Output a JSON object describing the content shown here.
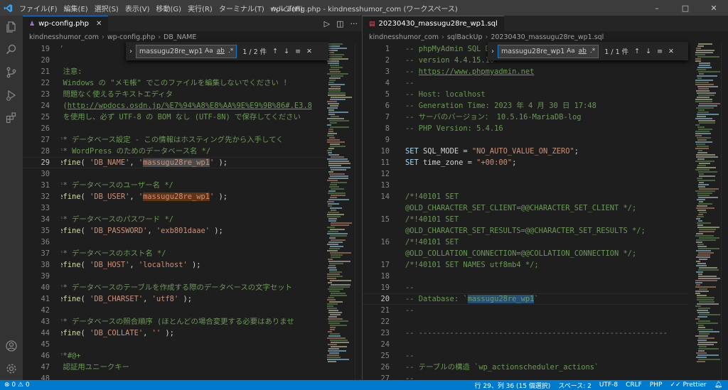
{
  "titlebar": {
    "menu": [
      "ファイル(F)",
      "編集(E)",
      "選択(S)",
      "表示(V)",
      "移動(G)",
      "実行(R)",
      "ターミナル(T)",
      "ヘルプ(H)"
    ],
    "title": "wp-config.php - kindnesshumor_com (ワークスペース)",
    "window_controls": [
      "–",
      "□",
      "✕"
    ]
  },
  "left_editor": {
    "tab_label": "wp-config.php",
    "breadcrumb": [
      "kindnesshumor_com",
      "wp-config.php",
      "DB_NAME"
    ],
    "find": {
      "query": "massugu28re_wp1",
      "count": "1 / 2 件",
      "opt_case": "Aa",
      "opt_word": "ab",
      "opt_regex": ".*"
    },
    "lines": [
      {
        "n": "19",
        "cur": false,
        "segs": [
          {
            "t": "*/",
            "c": "cmt"
          }
        ]
      },
      {
        "n": "20",
        "cur": false,
        "segs": []
      },
      {
        "n": "21",
        "cur": false,
        "segs": [
          {
            "t": "* 注意:",
            "c": "cmt"
          }
        ]
      },
      {
        "n": "22",
        "cur": false,
        "segs": [
          {
            "t": "* Windows の \"メモ帳\" でこのファイルを編集しないでください !",
            "c": "cmt"
          }
        ]
      },
      {
        "n": "23",
        "cur": false,
        "segs": [
          {
            "t": "* 問題なく使えるテキストエディタ",
            "c": "cmt"
          }
        ]
      },
      {
        "n": "24",
        "cur": false,
        "segs": [
          {
            "t": "* (",
            "c": "cmt"
          },
          {
            "t": "http://wpdocs.osdn.jp/%E7%94%A8%E8%AA%9E%E9%9B%86#.E3.8",
            "c": "link"
          }
        ]
      },
      {
        "n": "25",
        "cur": false,
        "segs": [
          {
            "t": "* を使用し、必ず UTF-8 の BOM なし (UTF-8N) で保存してください",
            "c": "cmt"
          }
        ]
      },
      {
        "n": "26",
        "cur": false,
        "segs": []
      },
      {
        "n": "27",
        "cur": false,
        "segs": [
          {
            "t": "/** データベース設定 - この情報はホスティング先から入手してく",
            "c": "cmt"
          }
        ]
      },
      {
        "n": "28",
        "cur": false,
        "segs": [
          {
            "t": "/** WordPress のためのデータベース名 */",
            "c": "cmt"
          }
        ]
      },
      {
        "n": "29",
        "cur": true,
        "segs": [
          {
            "t": "define",
            "c": "fn"
          },
          {
            "t": "( ",
            "c": "pl"
          },
          {
            "t": "'DB_NAME'",
            "c": "str"
          },
          {
            "t": ", ",
            "c": "pl"
          },
          {
            "t": "'",
            "c": "str"
          },
          {
            "t": "massugu28re_wp1",
            "c": "str hl1"
          },
          {
            "t": "'",
            "c": "str"
          },
          {
            "t": " );",
            "c": "pl"
          }
        ]
      },
      {
        "n": "30",
        "cur": false,
        "segs": []
      },
      {
        "n": "31",
        "cur": false,
        "segs": [
          {
            "t": "/** データベースのユーザー名 */",
            "c": "cmt"
          }
        ]
      },
      {
        "n": "32",
        "cur": false,
        "segs": [
          {
            "t": "define",
            "c": "fn"
          },
          {
            "t": "( ",
            "c": "pl"
          },
          {
            "t": "'DB_USER'",
            "c": "str"
          },
          {
            "t": ", ",
            "c": "pl"
          },
          {
            "t": "'",
            "c": "str"
          },
          {
            "t": "massugu28re_wp1",
            "c": "str hl2"
          },
          {
            "t": "'",
            "c": "str"
          },
          {
            "t": " );",
            "c": "pl"
          }
        ]
      },
      {
        "n": "33",
        "cur": false,
        "segs": []
      },
      {
        "n": "34",
        "cur": false,
        "segs": [
          {
            "t": "/** データベースのパスワード */",
            "c": "cmt"
          }
        ]
      },
      {
        "n": "35",
        "cur": false,
        "segs": [
          {
            "t": "define",
            "c": "fn"
          },
          {
            "t": "( ",
            "c": "pl"
          },
          {
            "t": "'DB_PASSWORD'",
            "c": "str"
          },
          {
            "t": ", ",
            "c": "pl"
          },
          {
            "t": "'exb801daae'",
            "c": "str"
          },
          {
            "t": " );",
            "c": "pl"
          }
        ]
      },
      {
        "n": "36",
        "cur": false,
        "segs": []
      },
      {
        "n": "37",
        "cur": false,
        "segs": [
          {
            "t": "/** データベースのホスト名 */",
            "c": "cmt"
          }
        ]
      },
      {
        "n": "38",
        "cur": false,
        "segs": [
          {
            "t": "define",
            "c": "fn"
          },
          {
            "t": "( ",
            "c": "pl"
          },
          {
            "t": "'DB_HOST'",
            "c": "str"
          },
          {
            "t": ", ",
            "c": "pl"
          },
          {
            "t": "'localhost'",
            "c": "str"
          },
          {
            "t": " );",
            "c": "pl"
          }
        ]
      },
      {
        "n": "39",
        "cur": false,
        "segs": []
      },
      {
        "n": "40",
        "cur": false,
        "segs": [
          {
            "t": "/** データベースのテーブルを作成する際のデータベースの文字セット",
            "c": "cmt"
          }
        ]
      },
      {
        "n": "41",
        "cur": false,
        "segs": [
          {
            "t": "define",
            "c": "fn"
          },
          {
            "t": "( ",
            "c": "pl"
          },
          {
            "t": "'DB_CHARSET'",
            "c": "str"
          },
          {
            "t": ", ",
            "c": "pl"
          },
          {
            "t": "'utf8'",
            "c": "str"
          },
          {
            "t": " );",
            "c": "pl"
          }
        ]
      },
      {
        "n": "42",
        "cur": false,
        "segs": []
      },
      {
        "n": "43",
        "cur": false,
        "segs": [
          {
            "t": "/** データベースの照合順序 (ほとんどの場合変更する必要はありませ",
            "c": "cmt"
          }
        ]
      },
      {
        "n": "44",
        "cur": false,
        "segs": [
          {
            "t": "define",
            "c": "fn"
          },
          {
            "t": "( ",
            "c": "pl"
          },
          {
            "t": "'DB_COLLATE'",
            "c": "str"
          },
          {
            "t": ", ",
            "c": "pl"
          },
          {
            "t": "''",
            "c": "str"
          },
          {
            "t": " );",
            "c": "pl"
          }
        ]
      },
      {
        "n": "45",
        "cur": false,
        "segs": []
      },
      {
        "n": "46",
        "cur": false,
        "segs": [
          {
            "t": "/**#@+",
            "c": "cmt"
          }
        ]
      },
      {
        "n": "47",
        "cur": false,
        "segs": [
          {
            "t": "* 認証用ユニークキー",
            "c": "cmt"
          }
        ]
      },
      {
        "n": "48",
        "cur": false,
        "segs": [
          {
            "t": "*",
            "c": "cmt"
          }
        ]
      }
    ]
  },
  "right_editor": {
    "tab_label": "20230430_massugu28re_wp1.sql",
    "breadcrumb": [
      "kindnesshumor_com",
      "sqlBackUp",
      "20230430_massugu28re_wp1.sql"
    ],
    "find": {
      "query": "massugu28re_wp1",
      "count": "1 / 1 件",
      "opt_case": "Aa",
      "opt_word": "ab",
      "opt_regex": ".*"
    },
    "lines": [
      {
        "n": "1",
        "cur": false,
        "segs": [
          {
            "t": "-- phpMyAdmin SQL Dump",
            "c": "cmt"
          }
        ]
      },
      {
        "n": "2",
        "cur": false,
        "segs": [
          {
            "t": "-- version 4.4.15.10",
            "c": "cmt"
          }
        ]
      },
      {
        "n": "3",
        "cur": false,
        "segs": [
          {
            "t": "-- ",
            "c": "cmt"
          },
          {
            "t": "https://www.phpmyadmin.net",
            "c": "link"
          }
        ]
      },
      {
        "n": "4",
        "cur": false,
        "segs": [
          {
            "t": "--",
            "c": "cmt"
          }
        ]
      },
      {
        "n": "5",
        "cur": false,
        "segs": [
          {
            "t": "-- Host: localhost",
            "c": "cmt"
          }
        ]
      },
      {
        "n": "6",
        "cur": false,
        "segs": [
          {
            "t": "-- Generation Time: 2023 年 4 月 30 日 17:48",
            "c": "cmt"
          }
        ]
      },
      {
        "n": "7",
        "cur": false,
        "segs": [
          {
            "t": "-- サーバのバージョン： 10.5.16-MariaDB-log",
            "c": "cmt"
          }
        ]
      },
      {
        "n": "8",
        "cur": false,
        "segs": [
          {
            "t": "-- PHP Version: 5.4.16",
            "c": "cmt"
          }
        ]
      },
      {
        "n": "9",
        "cur": false,
        "segs": []
      },
      {
        "n": "10",
        "cur": false,
        "segs": [
          {
            "t": "SET",
            "c": "kw"
          },
          {
            "t": " SQL_MODE = ",
            "c": "pl"
          },
          {
            "t": "\"NO_AUTO_VALUE_ON_ZERO\"",
            "c": "str"
          },
          {
            "t": ";",
            "c": "pl"
          }
        ]
      },
      {
        "n": "11",
        "cur": false,
        "segs": [
          {
            "t": "SET",
            "c": "kw"
          },
          {
            "t": " time_zone = ",
            "c": "pl"
          },
          {
            "t": "\"+00:00\"",
            "c": "str"
          },
          {
            "t": ";",
            "c": "pl"
          }
        ]
      },
      {
        "n": "12",
        "cur": false,
        "segs": []
      },
      {
        "n": "13",
        "cur": false,
        "segs": []
      },
      {
        "n": "14",
        "cur": false,
        "segs": [
          {
            "t": "/*!40101 SET",
            "c": "cmt"
          }
        ]
      },
      {
        "n": "",
        "cur": false,
        "segs": [
          {
            "t": "@OLD_CHARACTER_SET_CLIENT=@@CHARACTER_SET_CLIENT */;",
            "c": "cmt"
          }
        ]
      },
      {
        "n": "15",
        "cur": false,
        "segs": [
          {
            "t": "/*!40101 SET",
            "c": "cmt"
          }
        ]
      },
      {
        "n": "",
        "cur": false,
        "segs": [
          {
            "t": "@OLD_CHARACTER_SET_RESULTS=@@CHARACTER_SET_RESULTS */;",
            "c": "cmt"
          }
        ]
      },
      {
        "n": "16",
        "cur": false,
        "segs": [
          {
            "t": "/*!40101 SET",
            "c": "cmt"
          }
        ]
      },
      {
        "n": "",
        "cur": false,
        "segs": [
          {
            "t": "@OLD_COLLATION_CONNECTION=@@COLLATION_CONNECTION */;",
            "c": "cmt"
          }
        ]
      },
      {
        "n": "17",
        "cur": false,
        "segs": [
          {
            "t": "/*!40101 SET NAMES utf8mb4 */;",
            "c": "cmt"
          }
        ]
      },
      {
        "n": "18",
        "cur": false,
        "segs": []
      },
      {
        "n": "19",
        "cur": false,
        "segs": [
          {
            "t": "--",
            "c": "cmt"
          }
        ]
      },
      {
        "n": "20",
        "cur": true,
        "segs": [
          {
            "t": "-- Database: `",
            "c": "cmt"
          },
          {
            "t": "massugu28re_wp1",
            "c": "cmt hl3"
          },
          {
            "t": "`",
            "c": "cmt"
          }
        ]
      },
      {
        "n": "21",
        "cur": false,
        "segs": [
          {
            "t": "--",
            "c": "cmt"
          }
        ]
      },
      {
        "n": "22",
        "cur": false,
        "segs": []
      },
      {
        "n": "23",
        "cur": false,
        "segs": [
          {
            "t": "-- --------------------------------------------------------",
            "c": "cmt"
          }
        ]
      },
      {
        "n": "24",
        "cur": false,
        "segs": []
      },
      {
        "n": "25",
        "cur": false,
        "segs": [
          {
            "t": "--",
            "c": "cmt"
          }
        ]
      },
      {
        "n": "26",
        "cur": false,
        "segs": [
          {
            "t": "-- テーブルの構造 `wp_actionscheduler_actions`",
            "c": "cmt"
          }
        ]
      },
      {
        "n": "27",
        "cur": false,
        "segs": [
          {
            "t": "--",
            "c": "cmt"
          }
        ]
      }
    ]
  },
  "statusbar": {
    "errors": "0",
    "warnings": "0",
    "cursor_pos": "行 29、列 36 (15 個選択)",
    "indent": "スペース: 2",
    "encoding": "UTF-8",
    "eol": "CRLF",
    "language": "PHP",
    "formatter": "Prettier"
  },
  "colors": {
    "statusbar": "#007acc",
    "accent": "#0e7ad3",
    "comment": "#6a9955",
    "string": "#ce9178",
    "keyword": "#9cdcfe"
  }
}
